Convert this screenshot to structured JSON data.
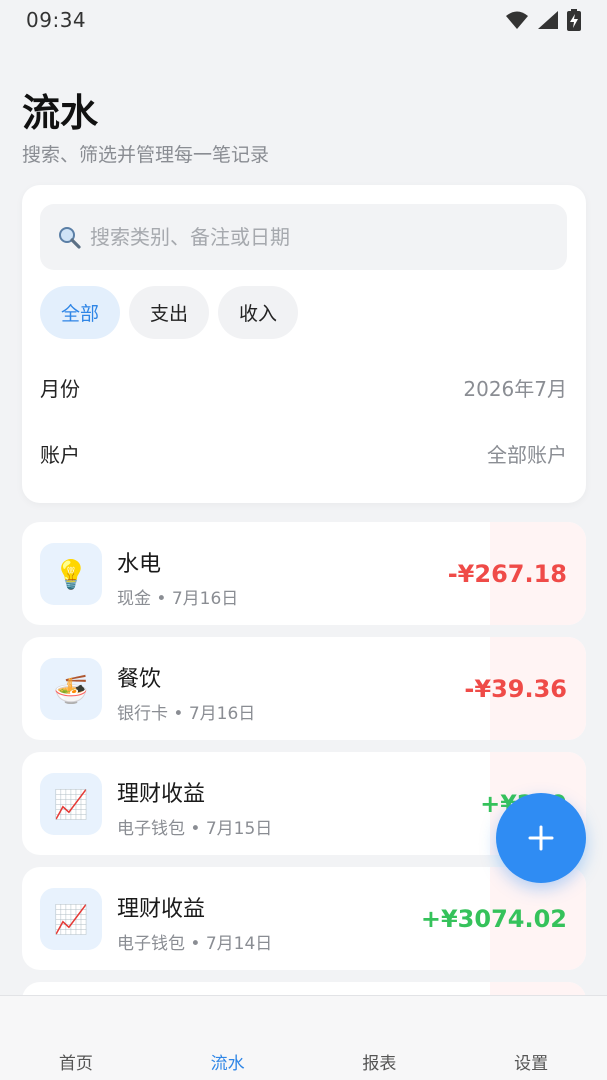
{
  "status_bar": {
    "time": "09:34"
  },
  "header": {
    "title": "流水",
    "subtitle": "搜索、筛选并管理每一笔记录"
  },
  "search": {
    "placeholder": "搜索类别、备注或日期",
    "value": ""
  },
  "type_filter": {
    "options": [
      "全部",
      "支出",
      "收入"
    ],
    "selected": "全部"
  },
  "filters": {
    "month_label": "月份",
    "month_value": "2026年7月",
    "account_label": "账户",
    "account_value": "全部账户"
  },
  "transactions": [
    {
      "icon": "lightbulb-icon",
      "glyph": "💡",
      "name": "水电",
      "account": "现金",
      "date": "7月16日",
      "meta": "现金 • 7月16日",
      "amount": "-¥267.18",
      "kind": "expense"
    },
    {
      "icon": "noodle-bowl-icon",
      "glyph": "🍜",
      "name": "餐饮",
      "account": "银行卡",
      "date": "7月16日",
      "meta": "银行卡 • 7月16日",
      "amount": "-¥39.36",
      "kind": "expense"
    },
    {
      "icon": "chart-increasing-icon",
      "glyph": "📈",
      "name": "理财收益",
      "account": "电子钱包",
      "date": "7月15日",
      "meta": "电子钱包 • 7月15日",
      "amount": "+¥219",
      "kind": "income"
    },
    {
      "icon": "chart-increasing-icon",
      "glyph": "📈",
      "name": "理财收益",
      "account": "电子钱包",
      "date": "7月14日",
      "meta": "电子钱包 • 7月14日",
      "amount": "+¥3074.02",
      "kind": "income"
    }
  ],
  "bottom_nav": {
    "items": [
      "首页",
      "流水",
      "报表",
      "设置"
    ],
    "active": "流水"
  },
  "colors": {
    "accent": "#2f86e6",
    "expense": "#ef4b48",
    "income": "#35c25b"
  }
}
